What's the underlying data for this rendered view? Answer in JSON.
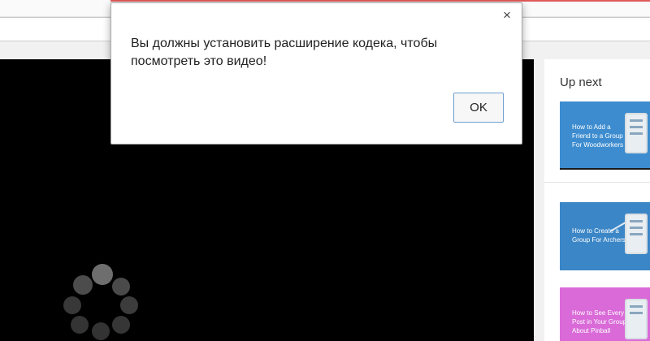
{
  "dialog": {
    "message": "Вы должны установить расширение кодека, чтобы посмотреть это видео!",
    "ok_label": "OK",
    "close_glyph": "×"
  },
  "sidebar": {
    "up_next_label": "Up next",
    "thumbnails": [
      {
        "text": "How to Add a Friend to a Group For Woodworkers",
        "color": "#3d8ccf"
      },
      {
        "text": "How to Create a Group For Archers",
        "color": "#3b86c6"
      },
      {
        "text": "How to See Every Post in Your Group About Pinball",
        "color": "#d96ad8"
      }
    ]
  },
  "player": {
    "spinner_icon": "loading-spinner-icon",
    "background": "#000000"
  },
  "colors": {
    "accent_line": "#e05a5a",
    "ok_border": "#6e9fd0"
  }
}
